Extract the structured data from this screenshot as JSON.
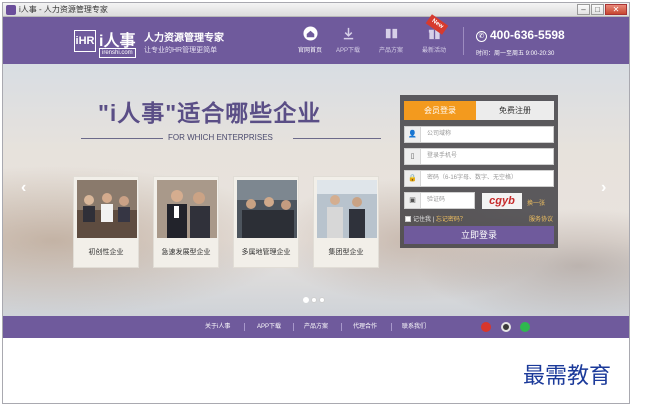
{
  "window": {
    "title": "i人事 - 人力资源管理专家"
  },
  "header": {
    "logo_mark": "iHR",
    "logo_name": "i人事",
    "logo_url": "irenshi.com",
    "slogan_title": "人力资源管理专家",
    "slogan_sub": "让专业的HR管理更简单",
    "nav": [
      {
        "label": "官网首页",
        "icon": "home-icon"
      },
      {
        "label": "APP下载",
        "icon": "download-icon"
      },
      {
        "label": "产品方案",
        "icon": "book-icon"
      },
      {
        "label": "最新活动",
        "icon": "gift-icon"
      }
    ],
    "new_badge": "New",
    "phone": "400-636-5598",
    "hours": "时间：周一至周五   9:00-20:30"
  },
  "hero": {
    "title": "\"i人事\"适合哪些企业",
    "subtitle": "FOR WHICH ENTERPRISES",
    "cards": [
      {
        "caption": "初创性企业"
      },
      {
        "caption": "急速发展型企业"
      },
      {
        "caption": "多属地管理企业"
      },
      {
        "caption": "集团型企业"
      }
    ]
  },
  "login": {
    "tab_member": "会员登录",
    "tab_register": "免费注册",
    "company_placeholder": "公司域称",
    "phone_placeholder": "登录手机号",
    "password_placeholder": "密码（6-16字母、数字、无空格）",
    "captcha_placeholder": "验证码",
    "captcha_text": "cgyb",
    "refresh_label": "换一张",
    "remember_label": "记住我",
    "forgot_label": "忘记密码？",
    "service_label": "服务协议",
    "submit_label": "立即登录"
  },
  "footer": {
    "links": [
      "关于i人事",
      "APP下载",
      "产品方案",
      "代理合作",
      "联系我们"
    ]
  },
  "watermark": "最需教育",
  "colors": {
    "brand": "#6f5a9c",
    "accent": "#f39a1e"
  }
}
